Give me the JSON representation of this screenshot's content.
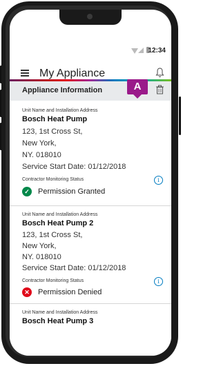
{
  "status_bar": {
    "time": "12:34"
  },
  "app_bar": {
    "title": "My Appliance"
  },
  "callout": {
    "label": "A"
  },
  "section": {
    "title": "Appliance Information"
  },
  "appliances": [
    {
      "unit_label": "Unit Name and Installation Address",
      "unit_name": "Bosch Heat Pump",
      "address_line1": "123, 1st Cross St,",
      "address_line2": "New York,",
      "address_line3": "NY. 018010",
      "service_start": "Service Start Date: 01/12/2018",
      "monitoring_label": "Contractor Monitoring Status",
      "permission": "Permission Granted"
    },
    {
      "unit_label": "Unit Name and Installation Address",
      "unit_name": "Bosch Heat Pump 2",
      "address_line1": "123, 1st Cross St,",
      "address_line2": "New York,",
      "address_line3": "NY. 018010",
      "service_start": "Service Start Date: 01/12/2018",
      "monitoring_label": "Contractor Monitoring Status",
      "permission": "Permission Denied"
    },
    {
      "unit_label": "Unit Name and Installation Address",
      "unit_name": "Bosch Heat Pump 3"
    }
  ]
}
